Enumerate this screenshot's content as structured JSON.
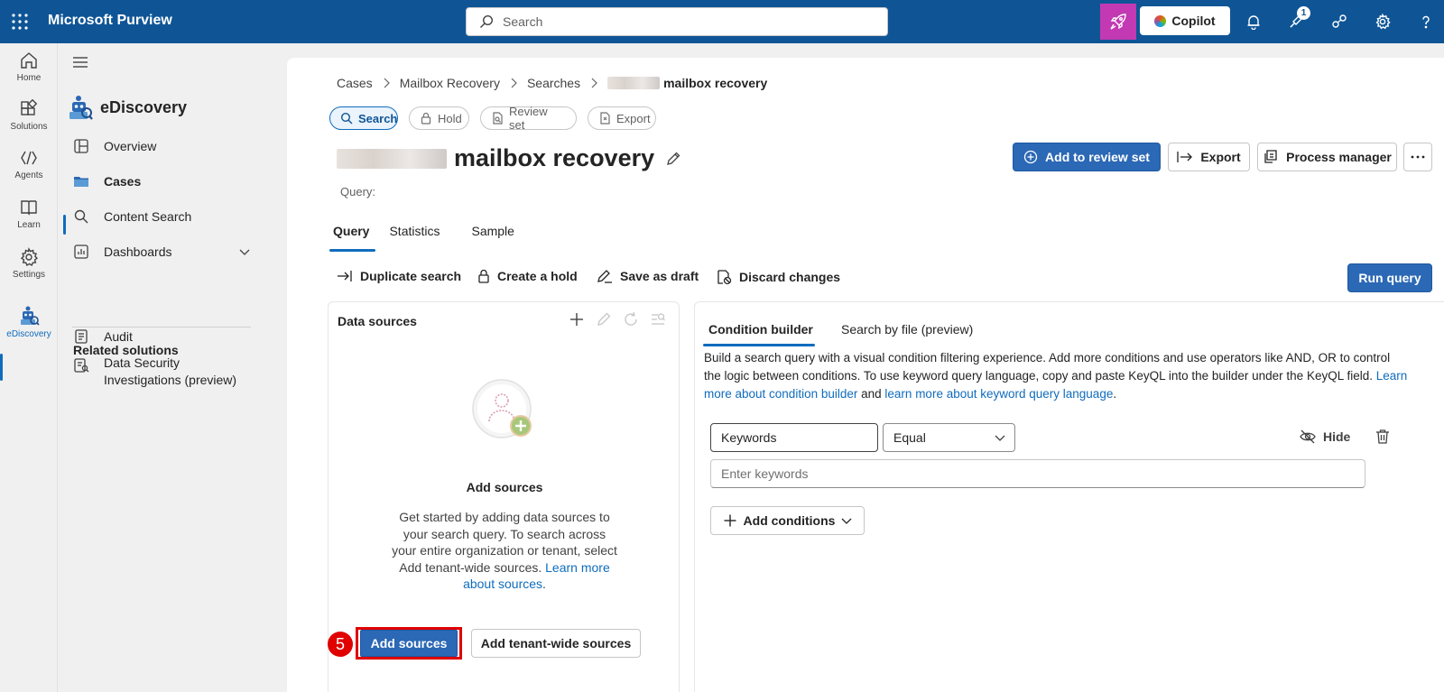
{
  "app": {
    "title": "Microsoft Purview"
  },
  "search": {
    "placeholder": "Search"
  },
  "topbar": {
    "copilot_label": "Copilot",
    "notification_count": "1"
  },
  "rail": {
    "items": [
      {
        "label": "Home",
        "icon": "home-icon"
      },
      {
        "label": "Solutions",
        "icon": "solutions-icon"
      },
      {
        "label": "Agents",
        "icon": "agents-icon"
      },
      {
        "label": "Learn",
        "icon": "learn-icon"
      },
      {
        "label": "Settings",
        "icon": "settings-icon"
      },
      {
        "label": "eDiscovery",
        "icon": "ediscovery-icon",
        "active": true
      }
    ]
  },
  "nav": {
    "title": "eDiscovery",
    "items": [
      {
        "label": "Overview",
        "icon": "overview-icon"
      },
      {
        "label": "Cases",
        "icon": "cases-icon",
        "active": true
      },
      {
        "label": "Content Search",
        "icon": "search-icon"
      },
      {
        "label": "Dashboards",
        "icon": "dashboards-icon"
      }
    ],
    "related_heading": "Related solutions",
    "related": [
      {
        "label": "Audit",
        "icon": "audit-icon"
      },
      {
        "label": "Data Security Investigations (preview)",
        "icon": "investigations-icon"
      }
    ]
  },
  "breadcrumb": {
    "items": [
      "Cases",
      "Mailbox Recovery",
      "Searches"
    ],
    "current": "mailbox recovery"
  },
  "pills": [
    {
      "label": "Search",
      "active": true
    },
    {
      "label": "Hold"
    },
    {
      "label": "Review set"
    },
    {
      "label": "Export"
    }
  ],
  "page": {
    "title": "mailbox recovery",
    "query_label": "Query:"
  },
  "header_buttons": {
    "add_to_review_set": "Add to review set",
    "export": "Export",
    "process_manager": "Process manager"
  },
  "tabs": [
    "Query",
    "Statistics",
    "Sample"
  ],
  "actions": {
    "duplicate": "Duplicate search",
    "hold": "Create a hold",
    "draft": "Save as draft",
    "discard": "Discard changes",
    "run": "Run query"
  },
  "data_sources": {
    "title": "Data sources",
    "heading": "Add sources",
    "description": "Get started by adding data sources to your search query. To search across your entire organization or tenant, select Add tenant-wide sources.",
    "link": "Learn more about sources",
    "add_button": "Add sources",
    "add_tenant_button": "Add tenant-wide sources",
    "step_number": "5"
  },
  "condition_builder": {
    "tabs": [
      "Condition builder",
      "Search by file (preview)"
    ],
    "description": "Build a search query with a visual condition filtering experience. Add more conditions and use operators like AND, OR to control the logic between conditions. To use keyword query language, copy and paste KeyQL into the builder under the KeyQL field.",
    "link1": "Learn more about condition builder",
    "and_text": "and",
    "link2": "learn more about keyword query language",
    "field_value": "Keywords",
    "operator_value": "Equal",
    "hide_label": "Hide",
    "keywords_placeholder": "Enter keywords",
    "add_conditions": "Add conditions"
  },
  "colors": {
    "topbar": "#0f5596",
    "accent": "#0f6cbd",
    "primary_button": "#2b68b5",
    "rocket": "#c239b3",
    "highlight": "#e00000"
  }
}
